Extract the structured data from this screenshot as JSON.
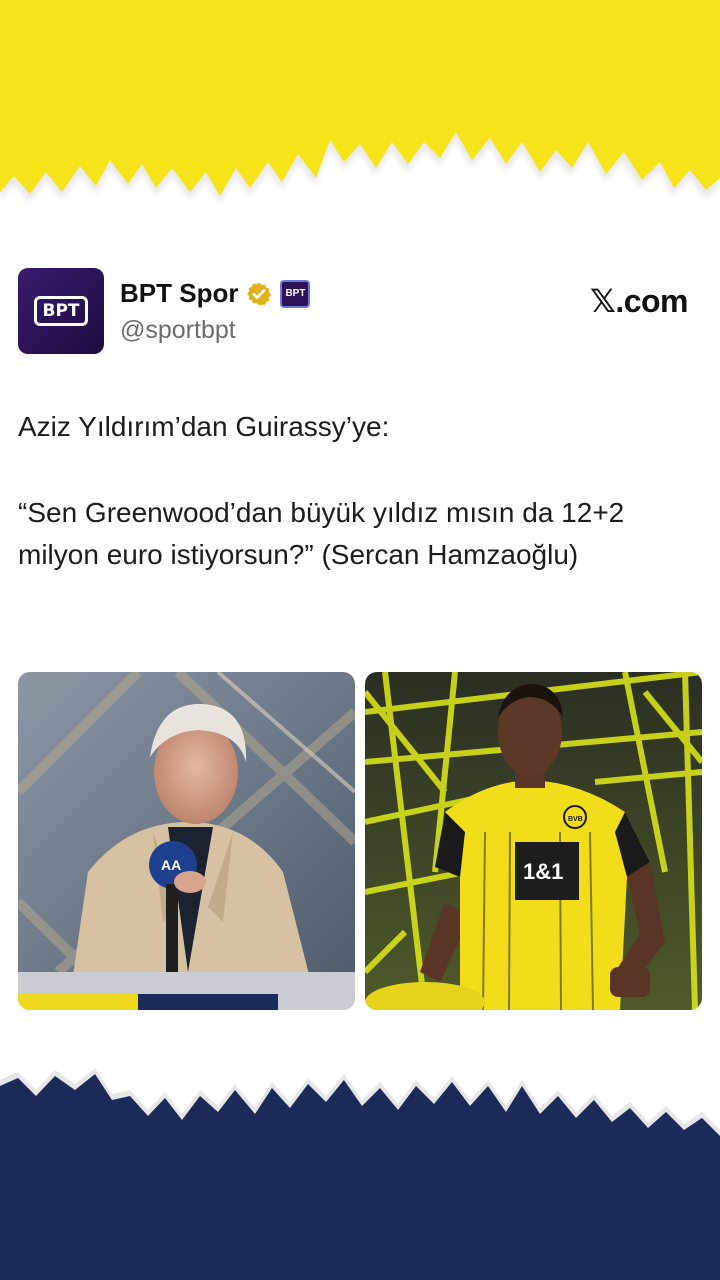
{
  "tweet": {
    "author_name": "BPT Spor",
    "handle": "@sportbpt",
    "avatar_text": "BPT",
    "brand": "𝕏.com",
    "text_line1": "Aziz Yıldırım’dan Guirassy’ye:",
    "text_line2": "“Sen Greenwood’dan büyük yıldız mısın da 12+2 milyon euro istiyorsun?” (Sercan Hamzaoğlu)"
  },
  "images": {
    "left": {
      "microphone_label": "AA"
    },
    "right": {
      "jersey_sponsor": "1&1",
      "club_crest": "BVB"
    }
  },
  "colors": {
    "top_band": "#f6e31a",
    "bottom_band": "#1c2a5a",
    "verified": "#e0b31c",
    "avatar": "#2b1357"
  }
}
